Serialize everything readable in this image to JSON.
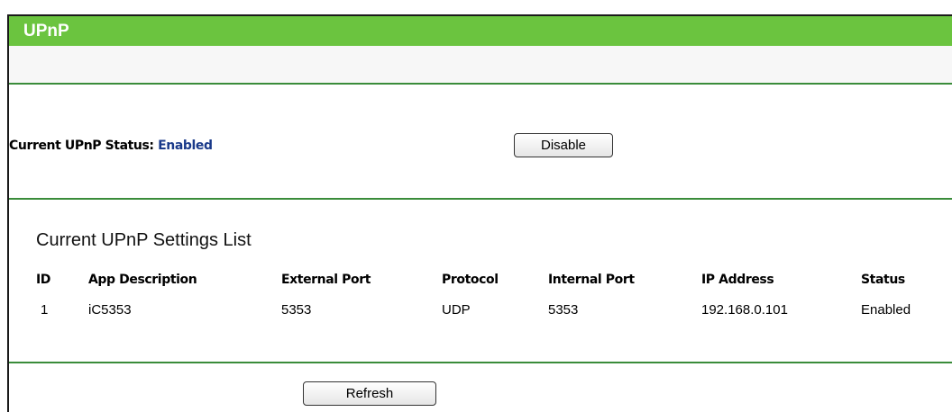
{
  "header": {
    "title": "UPnP"
  },
  "status": {
    "label": "Current UPnP Status:",
    "value": "Enabled",
    "toggle_button": "Disable"
  },
  "settings_list": {
    "title": "Current UPnP Settings List",
    "columns": [
      "ID",
      "App Description",
      "External Port",
      "Protocol",
      "Internal Port",
      "IP Address",
      "Status"
    ],
    "rows": [
      [
        "1",
        "iC5353",
        "5353",
        "UDP",
        "5353",
        "192.168.0.101",
        "Enabled"
      ]
    ]
  },
  "footer": {
    "refresh_button": "Refresh"
  },
  "colors": {
    "header_green": "#6bc43f",
    "rule_green": "#3a8c3a",
    "status_blue": "#1a3a8a"
  }
}
